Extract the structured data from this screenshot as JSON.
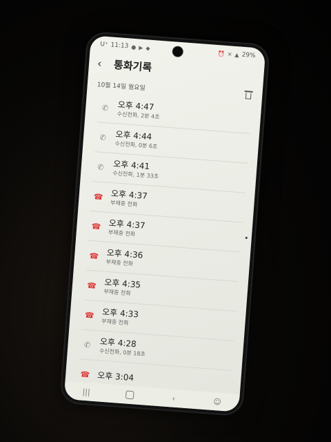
{
  "status_bar": {
    "carrier": "U⁺",
    "time": "11:13",
    "battery": "29%"
  },
  "header": {
    "title": "통화기록"
  },
  "date_label": "10월 14일 월요일",
  "calls": [
    {
      "time": "오후 4:47",
      "detail": "수신전화, 2분 4초",
      "type": "received"
    },
    {
      "time": "오후 4:44",
      "detail": "수신전화, 0분 6초",
      "type": "received"
    },
    {
      "time": "오후 4:41",
      "detail": "수신전화, 1분 33초",
      "type": "received"
    },
    {
      "time": "오후 4:37",
      "detail": "부재중 전화",
      "type": "missed"
    },
    {
      "time": "오후 4:37",
      "detail": "부재중 전화",
      "type": "missed"
    },
    {
      "time": "오후 4:36",
      "detail": "부재중 전화",
      "type": "missed"
    },
    {
      "time": "오후 4:35",
      "detail": "부재중 전화",
      "type": "missed"
    },
    {
      "time": "오후 4:33",
      "detail": "부재중 전화",
      "type": "missed"
    },
    {
      "time": "오후 4:28",
      "detail": "수신전화, 0분 18초",
      "type": "received"
    },
    {
      "time": "오후 3:04",
      "detail": "",
      "type": "missed"
    }
  ],
  "colors": {
    "missed": "#dd3333",
    "received": "#888888"
  },
  "icons": {
    "received": "call-received-icon",
    "missed": "call-missed-icon"
  }
}
